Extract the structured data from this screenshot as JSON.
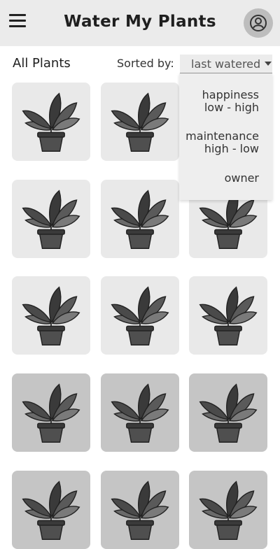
{
  "header": {
    "title": "Water My Plants",
    "menu_icon": "hamburger-menu-icon",
    "profile_icon": "user-avatar-icon"
  },
  "toolbar": {
    "heading": "All Plants",
    "sort_label": "Sorted by:",
    "sort_value": "last watered"
  },
  "sort_options": [
    {
      "line1": "happiness",
      "line2": "low - high"
    },
    {
      "line1": "maintenance",
      "line2": "high - low"
    },
    {
      "line1": "owner",
      "line2": ""
    }
  ],
  "plants_icon": "potted-plant-icon",
  "colors": {
    "header_bg": "#ebebeb",
    "card_bg": "#e9e9e9",
    "card_bg_needs_water": "#c5c5c5",
    "dropdown_bg": "#eeeeee"
  }
}
